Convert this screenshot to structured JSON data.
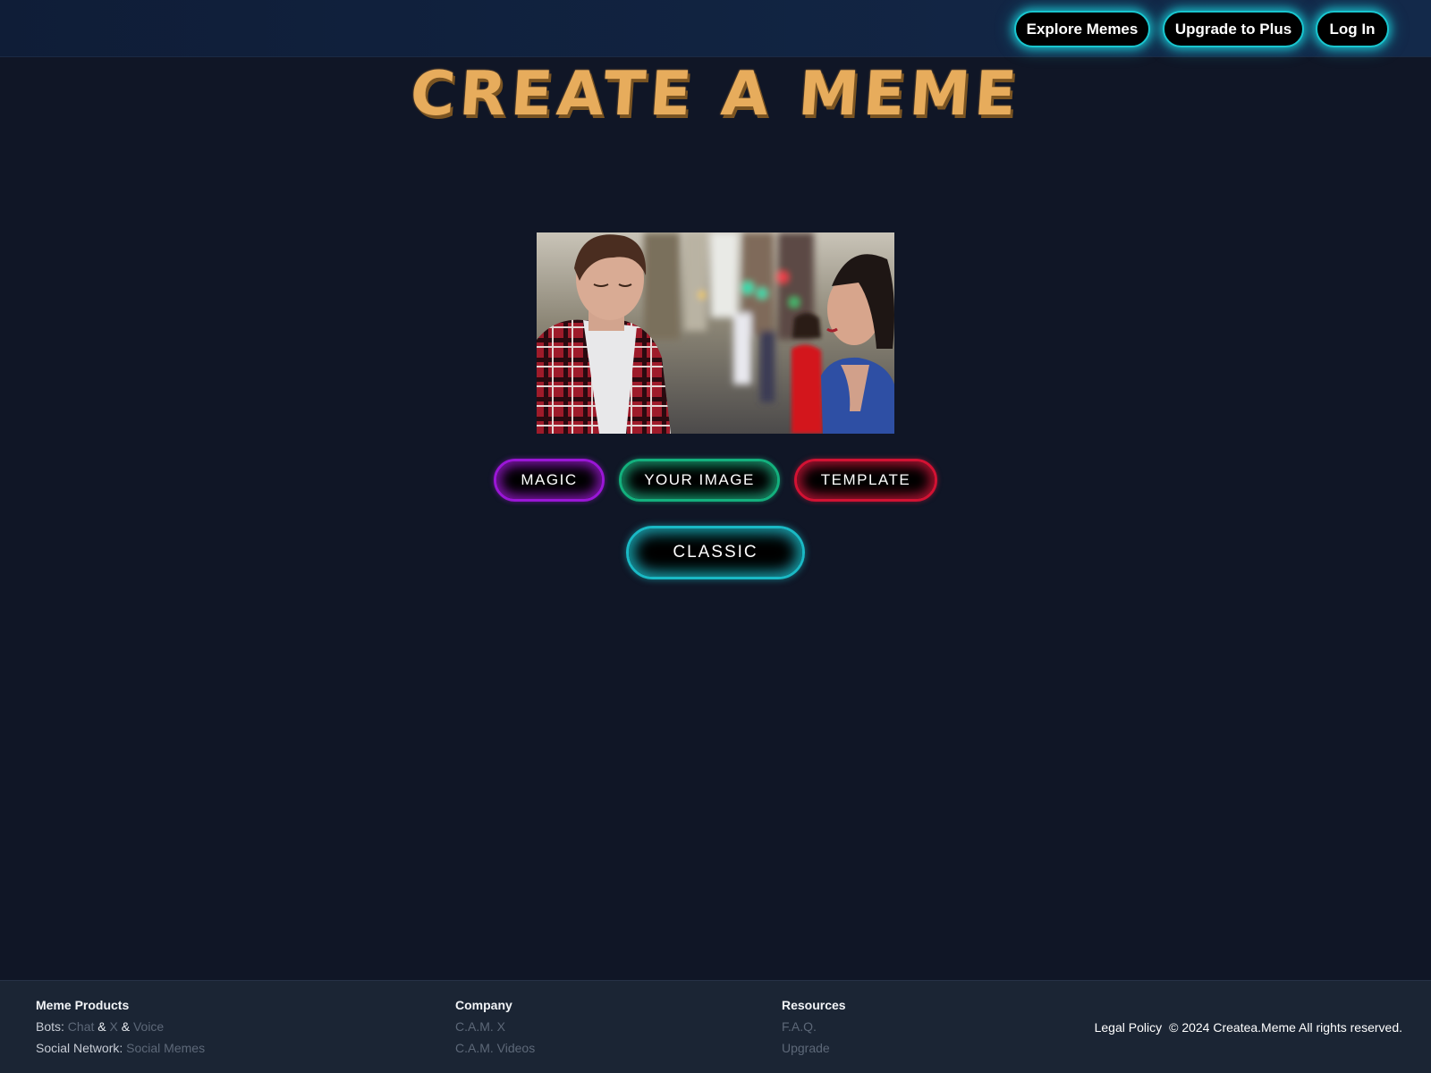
{
  "header": {
    "nav": [
      {
        "label": "Explore Memes"
      },
      {
        "label": "Upgrade to Plus"
      },
      {
        "label": "Log In"
      }
    ]
  },
  "main": {
    "title": "CREATE A MEME",
    "image": "meme-photo",
    "modes": [
      {
        "label": "MAGIC",
        "color": "#9a16d6"
      },
      {
        "label": "YOUR IMAGE",
        "color": "#13b07d"
      },
      {
        "label": "TEMPLATE",
        "color": "#d21233"
      }
    ],
    "classic": {
      "label": "CLASSIC",
      "color": "#1ab9c5"
    }
  },
  "footer": {
    "products": {
      "heading": "Meme Products",
      "bots_label": "Bots:",
      "bots_links": [
        "Chat",
        "X",
        "Voice"
      ],
      "separator": "&",
      "social_label": "Social Network:",
      "social_link": "Social Memes"
    },
    "company": {
      "heading": "Company",
      "links": [
        "C.A.M. X",
        "C.A.M. Videos"
      ]
    },
    "resources": {
      "heading": "Resources",
      "links": [
        "F.A.Q.",
        "Upgrade"
      ]
    },
    "legal": "Legal Policy",
    "copyright": "© 2024 Createa.Meme All rights reserved."
  },
  "colors": {
    "background": "#101626",
    "header": "#13294a",
    "title": "#e7ac5c",
    "nav_glow": "#19c6cf",
    "footer": "#1b2534"
  }
}
